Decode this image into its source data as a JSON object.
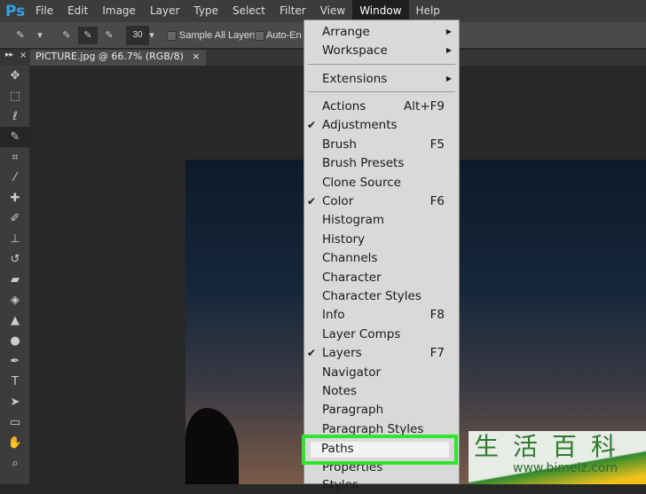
{
  "app": {
    "logo": "Ps"
  },
  "menubar": [
    "File",
    "Edit",
    "Image",
    "Layer",
    "Type",
    "Select",
    "Filter",
    "View",
    "Window",
    "Help"
  ],
  "options": {
    "brush_size": "30",
    "sample_all_layers": "Sample All Layers",
    "auto_enhance": "Auto-En"
  },
  "document_tab": {
    "title": "PICTURE.jpg @ 66.7% (RGB/8)",
    "close": "×"
  },
  "window_menu": {
    "items": [
      {
        "label": "Arrange",
        "submenu": true
      },
      {
        "label": "Workspace",
        "submenu": true
      },
      {
        "label": "Extensions",
        "submenu": true
      },
      {
        "label": "Actions",
        "shortcut": "Alt+F9"
      },
      {
        "label": "Adjustments",
        "checked": true
      },
      {
        "label": "Brush",
        "shortcut": "F5"
      },
      {
        "label": "Brush Presets"
      },
      {
        "label": "Clone Source"
      },
      {
        "label": "Color",
        "shortcut": "F6",
        "checked": true
      },
      {
        "label": "Histogram"
      },
      {
        "label": "History"
      },
      {
        "label": "Channels"
      },
      {
        "label": "Character"
      },
      {
        "label": "Character Styles"
      },
      {
        "label": "Info",
        "shortcut": "F8"
      },
      {
        "label": "Layer Comps"
      },
      {
        "label": "Layers",
        "shortcut": "F7",
        "checked": true
      },
      {
        "label": "Navigator"
      },
      {
        "label": "Notes"
      },
      {
        "label": "Paragraph"
      },
      {
        "label": "Paragraph Styles"
      },
      {
        "label": "Paths",
        "highlighted": true
      },
      {
        "label": "Properties"
      },
      {
        "label": "Styles"
      }
    ]
  },
  "highlight_color": "#2ee62e",
  "watermark": {
    "chinese": "生活百科",
    "url": "www.bimeiz.com"
  }
}
